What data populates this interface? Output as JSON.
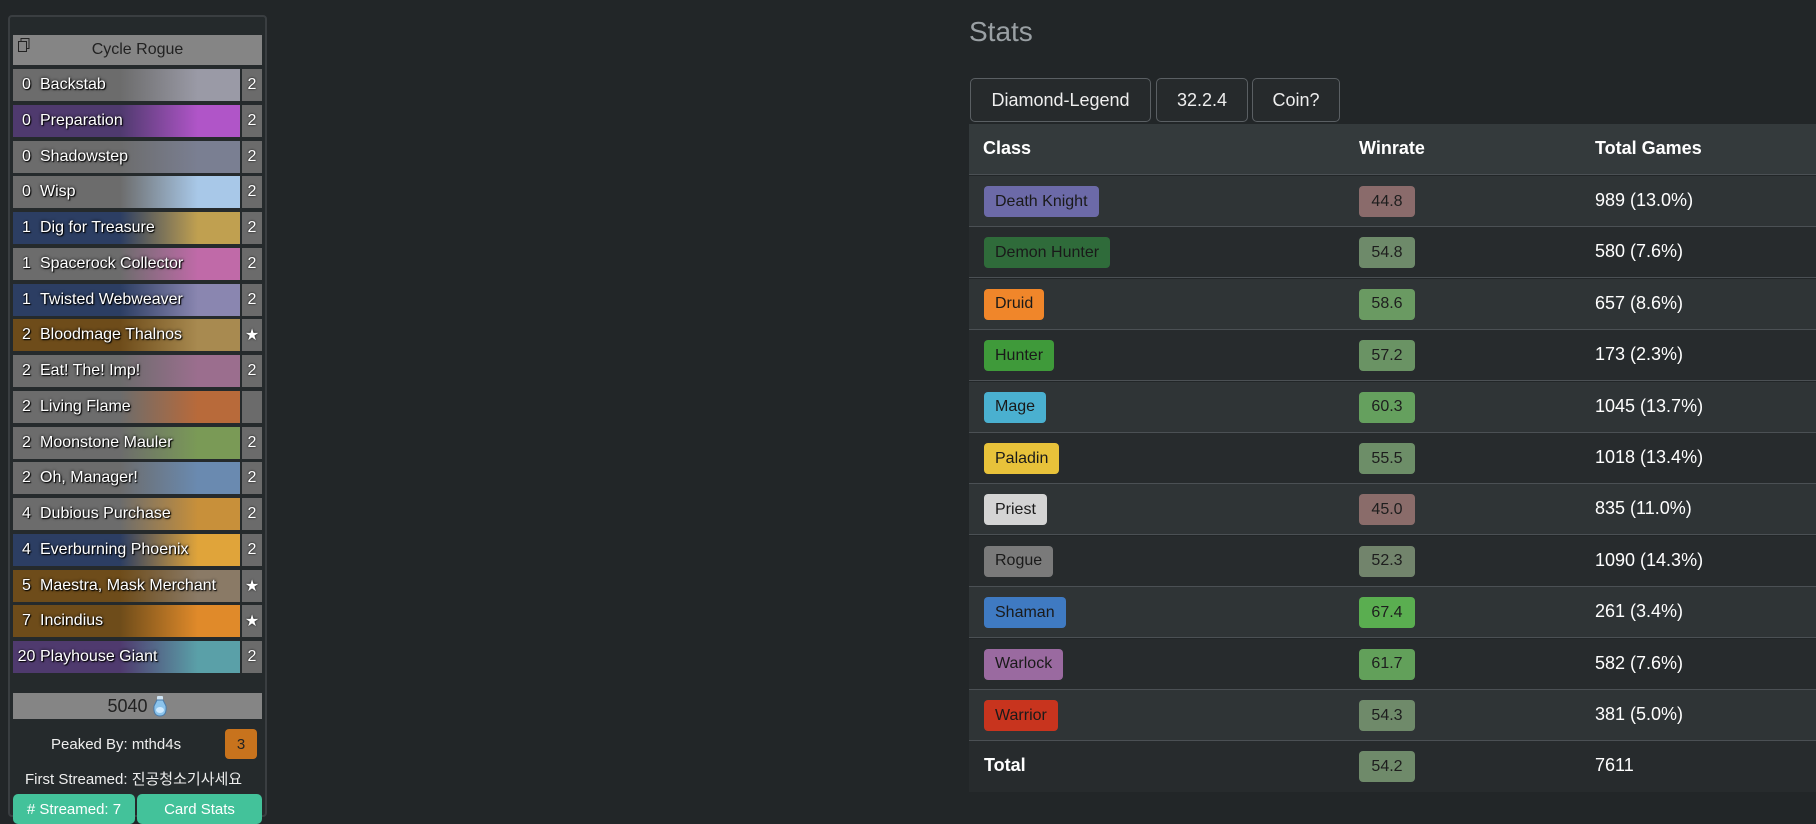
{
  "deck": {
    "title": "Cycle Rogue",
    "cards": [
      {
        "cost": "0",
        "name": "Backstab",
        "count": "2",
        "bg": "#6c6c6c",
        "art": "#9a9aa6"
      },
      {
        "cost": "0",
        "name": "Preparation",
        "count": "2",
        "bg": "#4f3a6e",
        "art": "#b055c8"
      },
      {
        "cost": "0",
        "name": "Shadowstep",
        "count": "2",
        "bg": "#6c6c6c",
        "art": "#7a7f92"
      },
      {
        "cost": "0",
        "name": "Wisp",
        "count": "2",
        "bg": "#6c6c6c",
        "art": "#a8c8e8"
      },
      {
        "cost": "1",
        "name": "Dig for Treasure",
        "count": "2",
        "bg": "#2c3e63",
        "art": "#c0a050"
      },
      {
        "cost": "1",
        "name": "Spacerock Collector",
        "count": "2",
        "bg": "#6c6c6c",
        "art": "#c06aa8"
      },
      {
        "cost": "1",
        "name": "Twisted Webweaver",
        "count": "2",
        "bg": "#2c3e63",
        "art": "#8a86b0"
      },
      {
        "cost": "2",
        "name": "Bloodmage Thalnos",
        "count": "★",
        "bg": "#6e4c1a",
        "art": "#a88a50"
      },
      {
        "cost": "2",
        "name": "Eat! The! Imp!",
        "count": "2",
        "bg": "#6c6c6c",
        "art": "#9b6e8e"
      },
      {
        "cost": "2",
        "name": "Living Flame",
        "count": "",
        "bg": "#6c6c6c",
        "art": "#b86a3a"
      },
      {
        "cost": "2",
        "name": "Moonstone Mauler",
        "count": "2",
        "bg": "#6c6c6c",
        "art": "#7a9a56"
      },
      {
        "cost": "2",
        "name": "Oh, Manager!",
        "count": "2",
        "bg": "#6c6c6c",
        "art": "#6a8ab0"
      },
      {
        "cost": "4",
        "name": "Dubious Purchase",
        "count": "2",
        "bg": "#6c6c6c",
        "art": "#c8903a"
      },
      {
        "cost": "4",
        "name": "Everburning Phoenix",
        "count": "2",
        "bg": "#2c3e63",
        "art": "#e0a43a"
      },
      {
        "cost": "5",
        "name": "Maestra, Mask Merchant",
        "count": "★",
        "bg": "#6e4c1a",
        "art": "#8a7a66"
      },
      {
        "cost": "7",
        "name": "Incindius",
        "count": "★",
        "bg": "#6e4c1a",
        "art": "#e08a2a"
      },
      {
        "cost": "20",
        "name": "Playhouse Giant",
        "count": "2",
        "bg": "#4f3a6e",
        "art": "#5aa0a8"
      }
    ],
    "dust": "5040",
    "peaked_by": "Peaked By: mthd4s",
    "peaked_rank": "3",
    "first_streamed": "First Streamed: 진공청소기사세요",
    "streamed_btn": "# Streamed: 7",
    "card_stats_btn": "Card Stats"
  },
  "stats": {
    "title": "Stats",
    "filters": [
      "Diamond-Legend",
      "32.2.4",
      "Coin?"
    ],
    "columns": [
      "Class",
      "Winrate",
      "Total Games"
    ],
    "rows": [
      {
        "class": "Death Knight",
        "color": "#6c6aa8",
        "winrate": "44.8",
        "wr_color": "#8a6b6b",
        "games": "989 (13.0%)"
      },
      {
        "class": "Demon Hunter",
        "color": "#2f6b3a",
        "winrate": "54.8",
        "wr_color": "#6e8a6a",
        "games": "580 (7.6%)"
      },
      {
        "class": "Druid",
        "color": "#f0862a",
        "winrate": "58.6",
        "wr_color": "#6a9a62",
        "games": "657 (8.6%)"
      },
      {
        "class": "Hunter",
        "color": "#3f9a3a",
        "winrate": "57.2",
        "wr_color": "#6a9364",
        "games": "173 (2.3%)"
      },
      {
        "class": "Mage",
        "color": "#4ab0d0",
        "winrate": "60.3",
        "wr_color": "#65a05e",
        "games": "1045 (13.7%)"
      },
      {
        "class": "Paladin",
        "color": "#e8c23a",
        "winrate": "55.5",
        "wr_color": "#6d8e68",
        "games": "1018 (13.4%)"
      },
      {
        "class": "Priest",
        "color": "#d4d4d4",
        "winrate": "45.0",
        "wr_color": "#8a6c6a",
        "games": "835 (11.0%)"
      },
      {
        "class": "Rogue",
        "color": "#7a7a7a",
        "winrate": "52.3",
        "wr_color": "#72846c",
        "games": "1090 (14.3%)"
      },
      {
        "class": "Shaman",
        "color": "#3f7ac2",
        "winrate": "67.4",
        "wr_color": "#5aae50",
        "games": "261 (3.4%)"
      },
      {
        "class": "Warlock",
        "color": "#9a6aa0",
        "winrate": "61.7",
        "wr_color": "#62a05a",
        "games": "582 (7.6%)"
      },
      {
        "class": "Warrior",
        "color": "#c8341e",
        "winrate": "54.3",
        "wr_color": "#6f8a6a",
        "games": "381 (5.0%)"
      }
    ],
    "total_label": "Total",
    "total_winrate": "54.2",
    "total_wr_color": "#6f8a6a",
    "total_games": "7611"
  }
}
